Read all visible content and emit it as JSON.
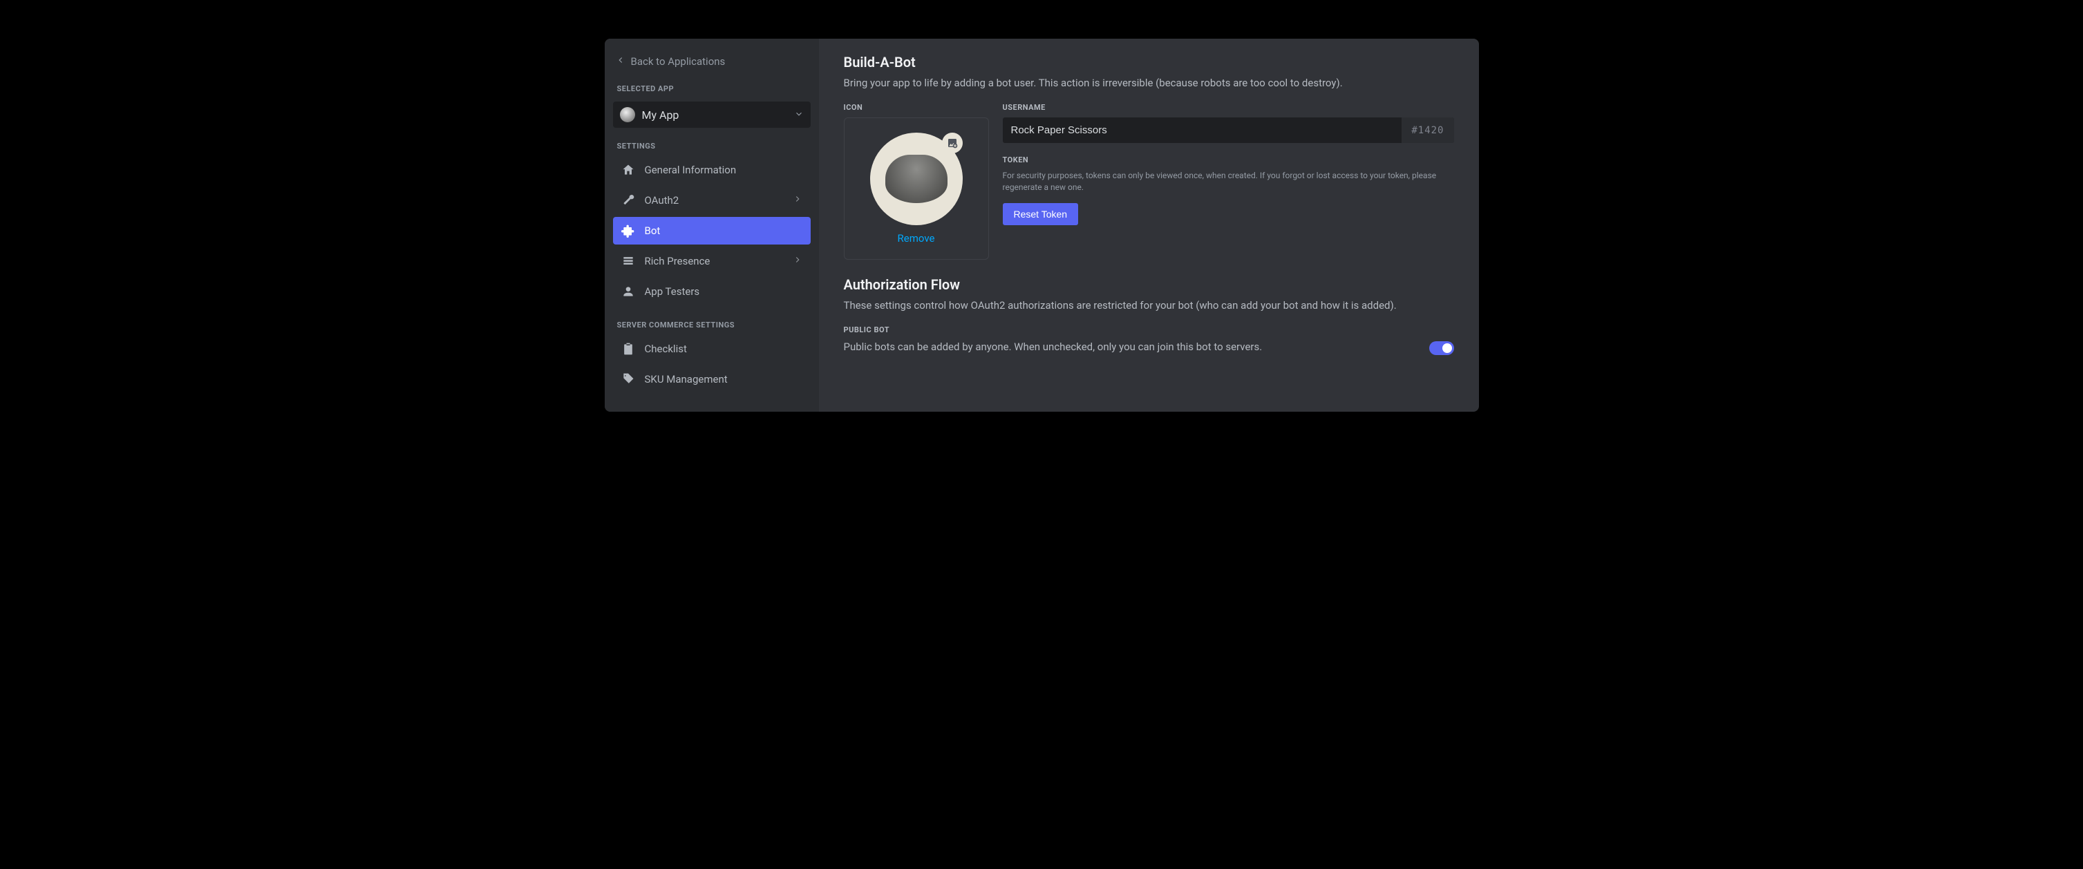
{
  "sidebar": {
    "back_label": "Back to Applications",
    "selected_app_heading": "SELECTED APP",
    "app_name": "My App",
    "settings_heading": "SETTINGS",
    "items": [
      {
        "label": "General Information"
      },
      {
        "label": "OAuth2"
      },
      {
        "label": "Bot"
      },
      {
        "label": "Rich Presence"
      },
      {
        "label": "App Testers"
      }
    ],
    "commerce_heading": "SERVER COMMERCE SETTINGS",
    "commerce_items": [
      {
        "label": "Checklist"
      },
      {
        "label": "SKU Management"
      }
    ]
  },
  "build": {
    "title": "Build-A-Bot",
    "subtitle": "Bring your app to life by adding a bot user. This action is irreversible (because robots are too cool to destroy).",
    "icon_label": "ICON",
    "remove_label": "Remove",
    "username_label": "USERNAME",
    "username_value": "Rock Paper Scissors",
    "discriminator": "#1420",
    "token_label": "TOKEN",
    "token_note": "For security purposes, tokens can only be viewed once, when created. If you forgot or lost access to your token, please regenerate a new one.",
    "reset_token_label": "Reset Token"
  },
  "auth": {
    "title": "Authorization Flow",
    "subtitle": "These settings control how OAuth2 authorizations are restricted for your bot (who can add your bot and how it is added).",
    "public_bot_label": "PUBLIC BOT",
    "public_bot_desc": "Public bots can be added by anyone. When unchecked, only you can join this bot to servers.",
    "public_bot_on": true
  }
}
